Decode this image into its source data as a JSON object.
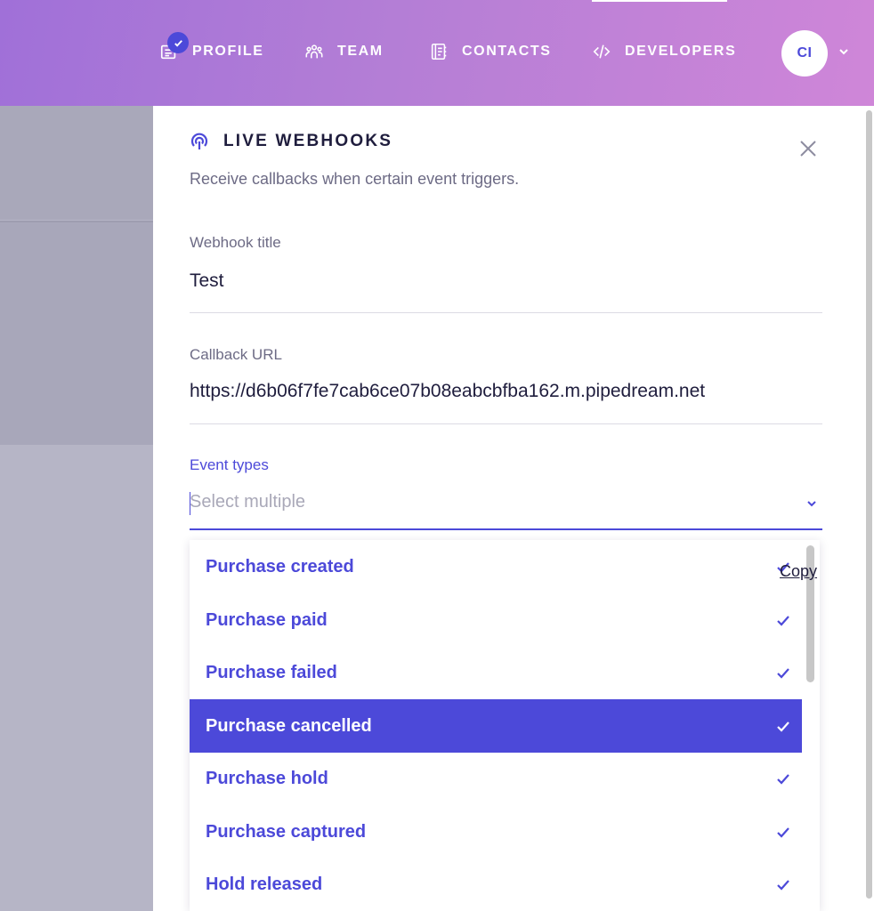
{
  "nav": {
    "items": [
      {
        "label": "PROFILE",
        "icon": "profile-icon"
      },
      {
        "label": "TEAM",
        "icon": "team-icon"
      },
      {
        "label": "CONTACTS",
        "icon": "contacts-icon"
      },
      {
        "label": "DEVELOPERS",
        "icon": "code-icon"
      }
    ],
    "avatar_initials": "CI"
  },
  "panel": {
    "title": "LIVE WEBHOOKS",
    "subtitle": "Receive callbacks when certain event triggers.",
    "fields": {
      "webhook_title_label": "Webhook title",
      "webhook_title_value": "Test",
      "callback_url_label": "Callback URL",
      "callback_url_value": "https://d6b06f7fe7cab6ce07b08eabcbfba162.m.pipedream.net"
    },
    "event_types": {
      "label": "Event types",
      "placeholder": "Select multiple",
      "options": [
        {
          "label": "Purchase created",
          "checked": true,
          "highlighted": false
        },
        {
          "label": "Purchase paid",
          "checked": true,
          "highlighted": false
        },
        {
          "label": "Purchase failed",
          "checked": true,
          "highlighted": false
        },
        {
          "label": "Purchase cancelled",
          "checked": true,
          "highlighted": true
        },
        {
          "label": "Purchase hold",
          "checked": true,
          "highlighted": false
        },
        {
          "label": "Purchase captured",
          "checked": true,
          "highlighted": false
        },
        {
          "label": "Hold released",
          "checked": true,
          "highlighted": false
        }
      ]
    },
    "copy_label": "Copy"
  },
  "colors": {
    "accent": "#4c49d9",
    "header_gradient_start": "#a070d8",
    "header_gradient_end": "#cf86d8",
    "text_dark": "#1f1d3d",
    "text_muted": "#6d6b85"
  }
}
